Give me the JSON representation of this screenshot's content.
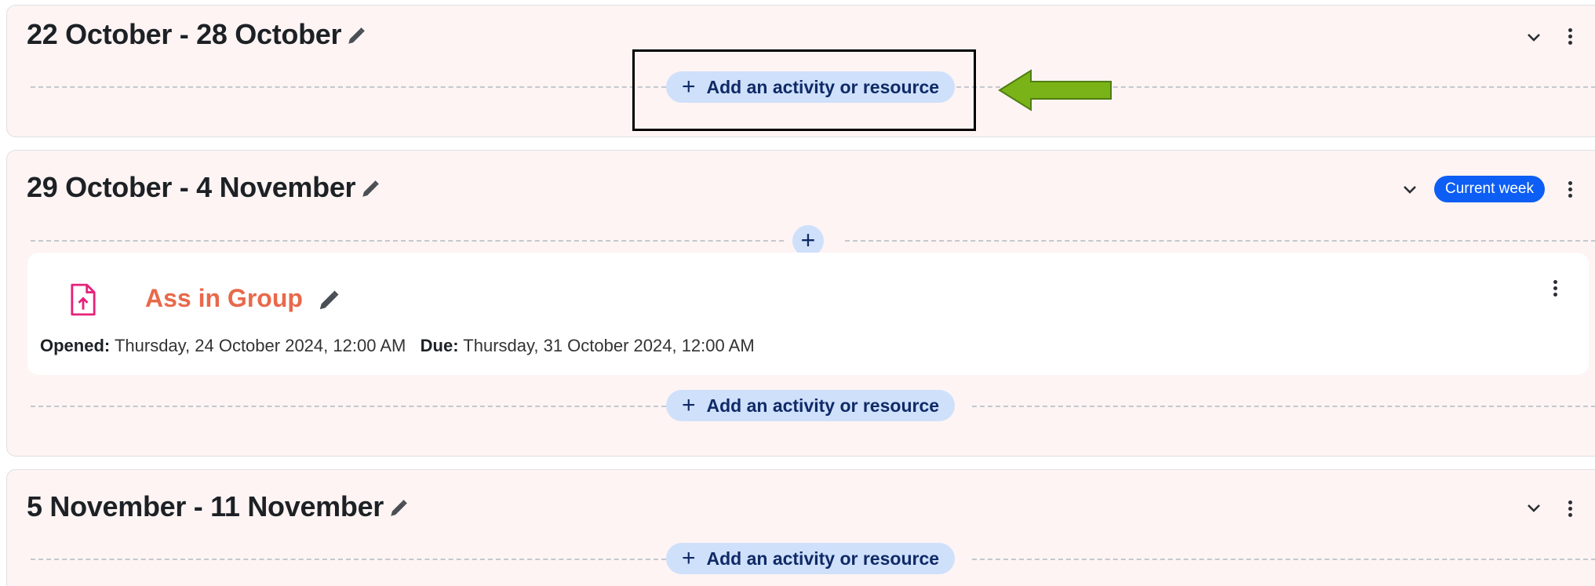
{
  "sections": [
    {
      "title": "22 October - 28 October",
      "add_label": "Add an activity or resource"
    },
    {
      "title": "29 October - 4 November",
      "badge": "Current week",
      "add_label": "Add an activity or resource",
      "activity": {
        "name": "Ass in Group",
        "opened_label": "Opened:",
        "opened_value": "Thursday, 24 October 2024, 12:00 AM",
        "due_label": "Due:",
        "due_value": "Thursday, 31 October 2024, 12:00 AM"
      }
    },
    {
      "title": "5 November - 11 November",
      "add_label": "Add an activity or resource"
    }
  ],
  "icons": {
    "edit": "pencil-icon",
    "collapse": "chevron-down-icon",
    "menu": "kebab-menu-icon",
    "add": "plus-icon",
    "activity": "assignment-upload-icon",
    "annotation": "green-arrow-left"
  },
  "colors": {
    "section_bg": "#fdf4f3",
    "add_pill_bg": "#cfe0fb",
    "add_pill_text": "#0f2a66",
    "badge_bg": "#0d5ef4",
    "activity_title": "#e8694a",
    "activity_icon": "#e7217a",
    "arrow": "#7ab317"
  }
}
